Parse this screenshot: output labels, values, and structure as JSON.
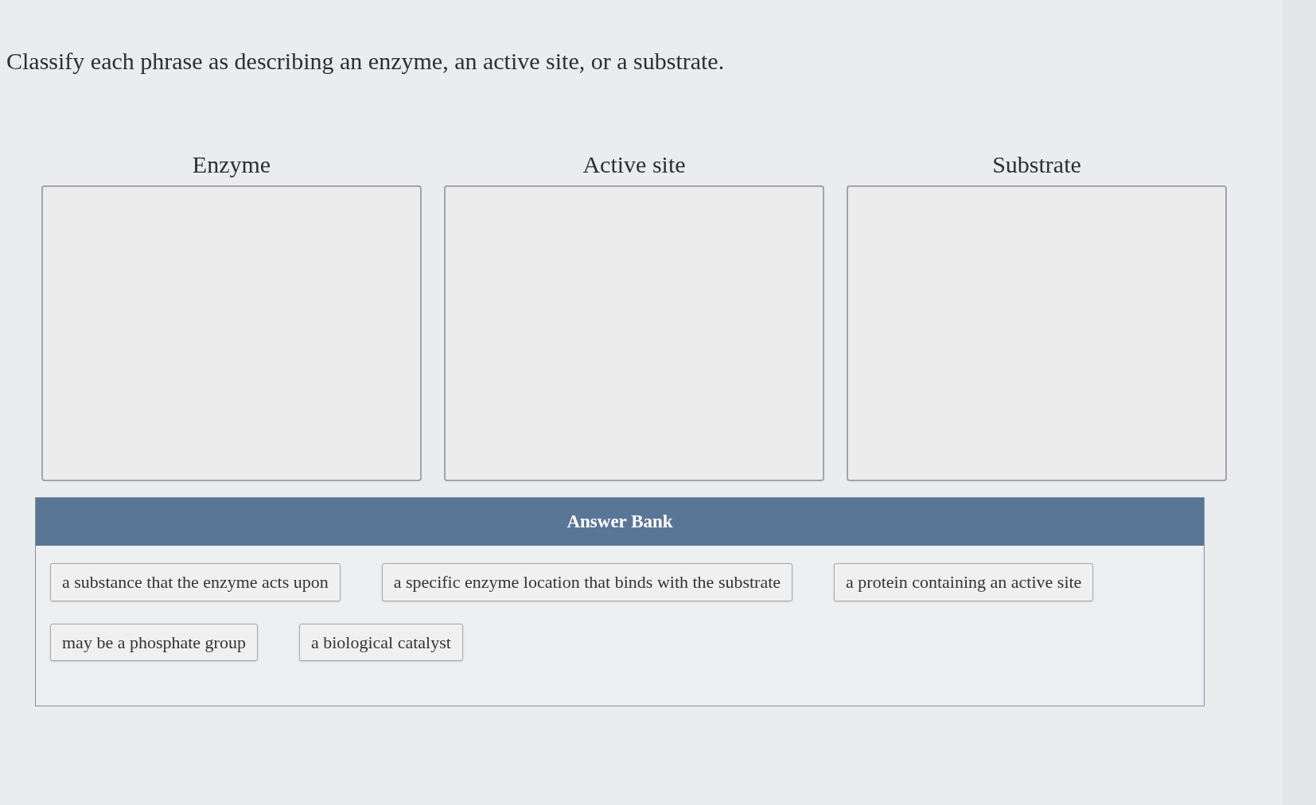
{
  "question": "Classify each phrase as describing an enzyme, an active site, or a substrate.",
  "categories": [
    {
      "label": "Enzyme"
    },
    {
      "label": "Active site"
    },
    {
      "label": "Substrate"
    }
  ],
  "answer_bank": {
    "title": "Answer Bank",
    "items": [
      "a substance that the enzyme acts upon",
      "a specific enzyme location that binds with the substrate",
      "a protein containing an active site",
      "may be a phosphate group",
      "a biological catalyst"
    ]
  }
}
